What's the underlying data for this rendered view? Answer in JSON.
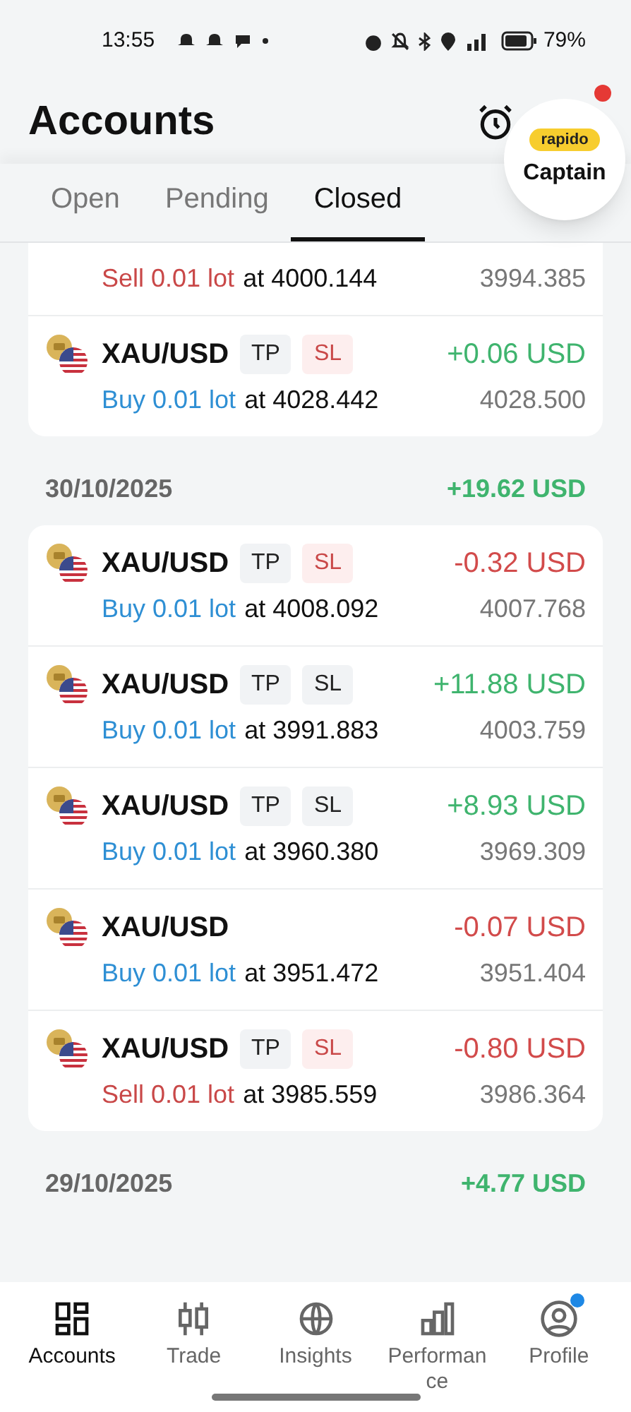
{
  "status_bar": {
    "time": "13:55",
    "battery": "79%"
  },
  "header": {
    "title": "Accounts",
    "notification_dot": true
  },
  "overlay_bubble": {
    "badge": "rapido",
    "label": "Captain"
  },
  "tabs": [
    {
      "label": "Open",
      "selected": false
    },
    {
      "label": "Pending",
      "selected": false
    },
    {
      "label": "Closed",
      "selected": true
    }
  ],
  "sections": [
    {
      "trades": [
        {
          "order": "Sell 0.01 lot",
          "sell": true,
          "price": "at 4000.144",
          "close": "3994.385"
        },
        {
          "symbol": "XAU/USD",
          "badges": [
            {
              "label": "TP",
              "triggered": false
            },
            {
              "label": "SL",
              "triggered": true
            }
          ],
          "pnl": "+0.06 USD",
          "negative": false,
          "order": "Buy 0.01 lot",
          "sell": false,
          "price": "at 4028.442",
          "close": "4028.500"
        }
      ]
    },
    {
      "date": "30/10/2025",
      "total": "+19.62 USD",
      "negative": false,
      "trades": [
        {
          "symbol": "XAU/USD",
          "badges": [
            {
              "label": "TP",
              "triggered": false
            },
            {
              "label": "SL",
              "triggered": true
            }
          ],
          "pnl": "-0.32 USD",
          "negative": true,
          "order": "Buy 0.01 lot",
          "sell": false,
          "price": "at 4008.092",
          "close": "4007.768"
        },
        {
          "symbol": "XAU/USD",
          "badges": [
            {
              "label": "TP",
              "triggered": false
            },
            {
              "label": "SL",
              "triggered": false
            }
          ],
          "pnl": "+11.88 USD",
          "negative": false,
          "order": "Buy 0.01 lot",
          "sell": false,
          "price": "at 3991.883",
          "close": "4003.759"
        },
        {
          "symbol": "XAU/USD",
          "badges": [
            {
              "label": "TP",
              "triggered": false
            },
            {
              "label": "SL",
              "triggered": false
            }
          ],
          "pnl": "+8.93 USD",
          "negative": false,
          "order": "Buy 0.01 lot",
          "sell": false,
          "price": "at 3960.380",
          "close": "3969.309"
        },
        {
          "symbol": "XAU/USD",
          "pnl": "-0.07 USD",
          "negative": true,
          "order": "Buy 0.01 lot",
          "sell": false,
          "price": "at 3951.472",
          "close": "3951.404"
        },
        {
          "symbol": "XAU/USD",
          "badges": [
            {
              "label": "TP",
              "triggered": false
            },
            {
              "label": "SL",
              "triggered": true
            }
          ],
          "pnl": "-0.80 USD",
          "negative": true,
          "order": "Sell 0.01 lot",
          "sell": true,
          "price": "at 3985.559",
          "close": "3986.364"
        }
      ]
    },
    {
      "date": "29/10/2025",
      "total": "+4.77 USD",
      "negative": false
    }
  ],
  "nav": [
    {
      "label": "Accounts",
      "kind": "accounts",
      "selected": true,
      "dot": false
    },
    {
      "label": "Trade",
      "kind": "trade",
      "selected": false,
      "dot": false
    },
    {
      "label": "Insights",
      "kind": "insights",
      "selected": false,
      "dot": false
    },
    {
      "label": "Performance",
      "kind": "performance",
      "selected": false,
      "dot": false
    },
    {
      "label": "Profile",
      "kind": "profile",
      "selected": false,
      "dot": true
    }
  ]
}
